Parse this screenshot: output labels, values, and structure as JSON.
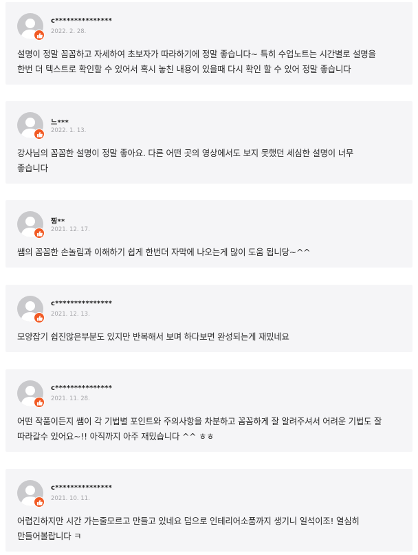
{
  "reviews": [
    {
      "name": "c***************",
      "date": "2022. 2. 28.",
      "text": "설명이 정말 꼼꼼하고 자세하여 초보자가 따라하기에 정말 좋습니다~ 특히 수업노트는 시간별로 설명을\n한번 더 텍스트로 확인할 수 있어서 혹시 놓친 내용이 있을때 다시 확인 할 수 있어 정말 좋습니다"
    },
    {
      "name": "느***",
      "date": "2022. 1. 13.",
      "text": "강사님의 꼼꼼한 설명이 정말 좋아요. 다른 어떤 곳의 영상에서도 보지 못했던 세심한 설명이 너무\n좋습니다"
    },
    {
      "name": "찡**",
      "date": "2021. 12. 17.",
      "text": "쌤의 꼼꼼한 손놀림과 이해하기 쉽게 한번더 자막에 나오는게 많이 도움 됩니당~^^"
    },
    {
      "name": "c***************",
      "date": "2021. 12. 13.",
      "text": "모양잡기 쉽진않은부분도 있지만 반복해서 보며 하다보면 완성되는게 재밌네요"
    },
    {
      "name": "c***************",
      "date": "2021. 11. 28.",
      "text": "어떤 작품이든지 쌤이 각 기법별 포인트와 주의사항을 차분하고 꼼꼼하게 잘 알려주셔서 어려운 기법도 잘\n따라갈수 있어요~!! 아직까지 아주 재밌습니다 ^^ ㅎㅎ"
    },
    {
      "name": "c***************",
      "date": "2021. 10. 11.",
      "text": "어렵긴하지만 시간 가는줄모르고 만들고 있네요 덤으로 인테리어소품까지 생기니 일석이조! 열심히\n만들어볼랍니다 ㅋ"
    }
  ],
  "icons": {
    "avatar": "default-user-icon",
    "badge": "thumbs-up-icon"
  },
  "colors": {
    "card_bg": "#f5f5f7",
    "badge": "#f15a24",
    "avatar": "#c9c9cc",
    "date": "#a6a6aa"
  }
}
